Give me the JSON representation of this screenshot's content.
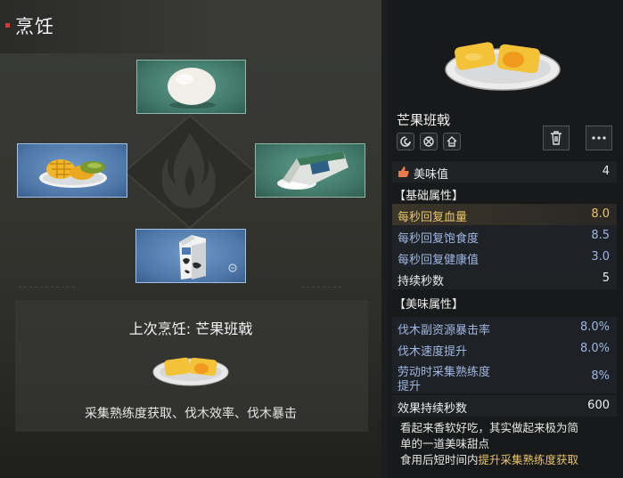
{
  "panel": {
    "title": "烹饪"
  },
  "slots": {
    "top": {
      "icon": "egg-icon"
    },
    "left": {
      "icon": "mango-plate-icon"
    },
    "right": {
      "icon": "flour-bag-icon"
    },
    "bottom": {
      "icon": "milk-carton-icon"
    }
  },
  "last_cook": {
    "title": "上次烹饪: 芒果班戟",
    "effects": "采集熟练度获取、伐木效率、伐木暴击"
  },
  "item": {
    "name": "芒果班戟",
    "tags": [
      "swirl-tag-icon",
      "crossed-tag-icon",
      "house-tag-icon"
    ],
    "rating": {
      "label": "美味值",
      "value": "4"
    },
    "base_header": "【基础属性】",
    "base_stats": [
      {
        "label": "每秒回复血量",
        "value": "8.0",
        "style": "hl"
      },
      {
        "label": "每秒回复饱食度",
        "value": "8.5",
        "style": "blue"
      },
      {
        "label": "每秒回复健康值",
        "value": "3.0",
        "style": "blue"
      },
      {
        "label": "持续秒数",
        "value": "5",
        "style": "white"
      }
    ],
    "bonus_header": "【美味属性】",
    "bonus_stats": [
      {
        "label": "伐木副资源暴击率",
        "value": "8.0%",
        "style": "blue"
      },
      {
        "label": "伐木速度提升",
        "value": "8.0%",
        "style": "blue"
      },
      {
        "label_line1": "劳动时采集熟练度",
        "label_line2": "提升",
        "value": "8%",
        "style": "blue"
      },
      {
        "label": "效果持续秒数",
        "value": "600",
        "style": "white"
      }
    ],
    "description": {
      "line1": "看起来香软好吃，其实做起来极为简",
      "line2": "单的一道美味甜点",
      "line3_prefix": "食用后短时间内",
      "line3_highlight": "提升采集熟练度获取"
    }
  },
  "colors": {
    "accent_gold": "#e8c46a",
    "stat_blue": "#9fb6e2",
    "title_marker": "#d23b2a",
    "slot_green": "#4f8a7a",
    "slot_blue": "#4d77a8"
  }
}
